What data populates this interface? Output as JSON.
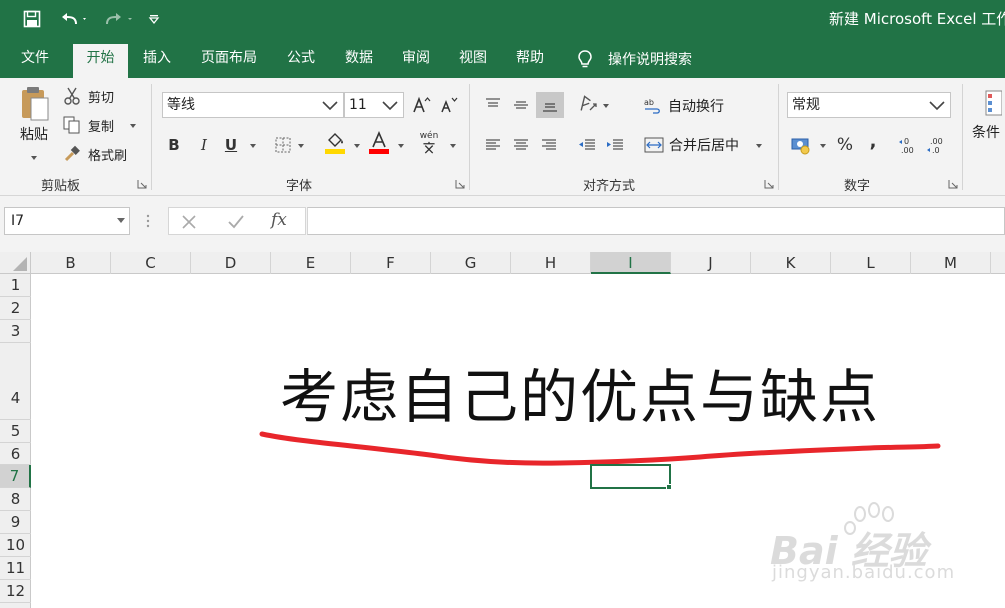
{
  "colors": {
    "accent": "#217346",
    "ribbon_bg": "#f3f3f3",
    "annotation_stroke": "#e8262b",
    "fill_color_swatch": "#ffd800",
    "font_color_swatch": "#ff0000"
  },
  "title_bar": {
    "doc_title": "新建 Microsoft Excel 工作表",
    "qat_icons": [
      "save-icon",
      "undo-icon",
      "redo-icon",
      "customize-qat-icon"
    ]
  },
  "tabs": [
    {
      "label": "文件"
    },
    {
      "label": "开始",
      "active": true
    },
    {
      "label": "插入"
    },
    {
      "label": "页面布局"
    },
    {
      "label": "公式"
    },
    {
      "label": "数据"
    },
    {
      "label": "审阅"
    },
    {
      "label": "视图"
    },
    {
      "label": "帮助"
    }
  ],
  "tell_me": {
    "label": "操作说明搜索",
    "icon": "lightbulb-icon"
  },
  "ribbon": {
    "clipboard": {
      "label": "剪贴板",
      "paste": "粘贴",
      "cut": "剪切",
      "copy": "复制",
      "format_painter": "格式刷"
    },
    "font": {
      "label": "字体",
      "font_name": "等线",
      "font_size": "11",
      "bold": "B",
      "italic": "I",
      "underline": "U",
      "phonetic": "wén"
    },
    "alignment": {
      "label": "对齐方式",
      "wrap_text": "自动换行",
      "merge_center": "合并后居中"
    },
    "number": {
      "label": "数字",
      "format": "常规",
      "percent": "%",
      "comma": ","
    },
    "styles": {
      "conditional_format": "条件"
    }
  },
  "formula_bar": {
    "name_box": "I7",
    "fx": "fx",
    "formula": ""
  },
  "grid": {
    "columns": [
      "B",
      "C",
      "D",
      "E",
      "F",
      "G",
      "H",
      "I",
      "J",
      "K",
      "L",
      "M"
    ],
    "selected_column": "I",
    "rows": [
      "1",
      "2",
      "3",
      "4",
      "5",
      "6",
      "7",
      "8",
      "9",
      "10",
      "11",
      "12"
    ],
    "selected_row": "7",
    "cell_text": "考虑自己的优点与缺点",
    "selected_cell": "I7"
  },
  "watermark": {
    "brand": "Bai 经验",
    "url": "jingyan.baidu.com"
  }
}
